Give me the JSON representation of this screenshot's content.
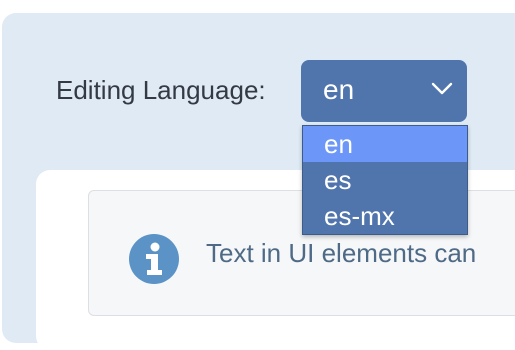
{
  "editing_language": {
    "label": "Editing Language:",
    "selected": "en",
    "options": [
      "en",
      "es",
      "es-mx"
    ],
    "highlighted_index": 0
  },
  "info_box": {
    "text": "Text in UI elements can",
    "icon": "info-circle-icon"
  },
  "colors": {
    "panel_bg": "#dfeaf4",
    "select_bg": "#5074ac",
    "option_highlight": "#6c96f8",
    "info_icon": "#5b93c7",
    "info_text": "#4e6a86"
  }
}
